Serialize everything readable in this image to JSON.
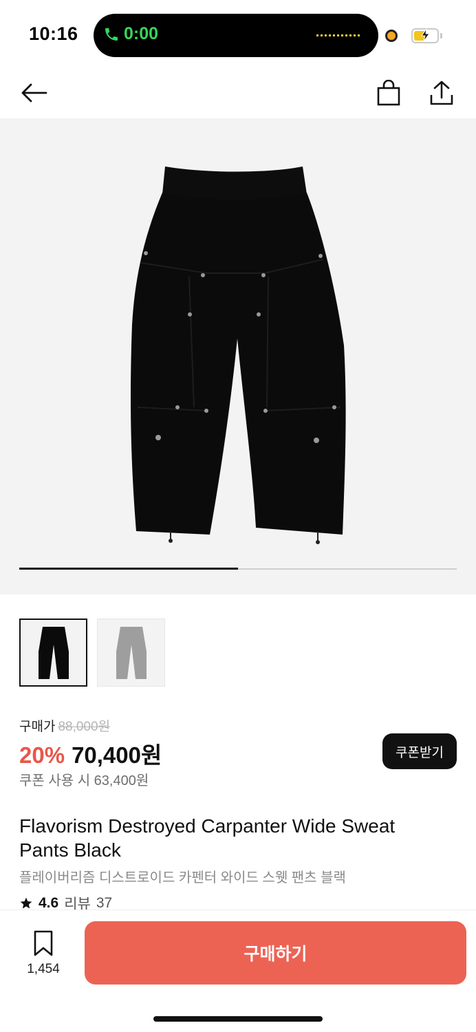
{
  "status_bar": {
    "time": "10:16",
    "call_duration": "0:00"
  },
  "nav": {
    "back_icon": "arrow-left-icon",
    "cart_icon": "shopping-bag-icon",
    "share_icon": "share-icon"
  },
  "gallery": {
    "progress": 0.5,
    "images": [
      "black-pants",
      "gray-pants"
    ],
    "selected_index": 0
  },
  "price": {
    "label": "구매가",
    "original": "88,000원",
    "discount": "20%",
    "sale": "70,400원",
    "coupon_info": "쿠폰 사용 시 63,400원",
    "coupon_button": "쿠폰받기"
  },
  "product": {
    "title_en": "Flavorism Destroyed Carpanter Wide Sweat Pants Black",
    "title_ko": "플레이버리즘 디스트로이드 카펜터 와이드 스웻 팬츠 블랙",
    "rating": "4.6",
    "review_label": "리뷰",
    "review_count": "37"
  },
  "bottom_bar": {
    "bookmark_count": "1,454",
    "buy_label": "구매하기"
  },
  "colors": {
    "accent": "#ec6354",
    "discount": "#e8574a"
  }
}
